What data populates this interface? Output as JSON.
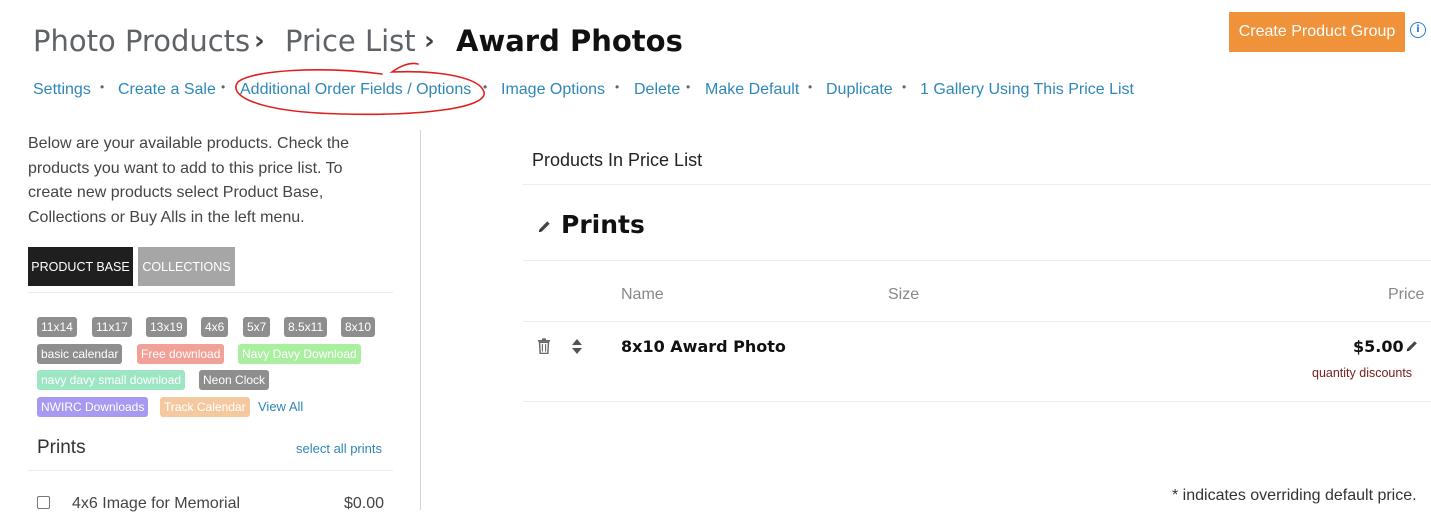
{
  "breadcrumb": {
    "items": [
      "Photo Products",
      "Price List"
    ],
    "current": "Award Photos"
  },
  "header": {
    "create_group_label": "Create Product Group",
    "info_symbol": "i"
  },
  "actions": {
    "links": [
      "Settings",
      "Create a Sale",
      "Additional Order Fields / Options",
      "Image Options",
      "Delete",
      "Make Default",
      "Duplicate",
      "1 Gallery Using This Price List"
    ],
    "separator": "•",
    "highlight_color": "#e0201c"
  },
  "left": {
    "intro": "Below are your available products. Check the products you want to add to this price list. To create new products select Product Base, Collections or Buy Alls in the left menu.",
    "tabs": {
      "product_base": "PRODUCT BASE",
      "collections": "COLLECTIONS"
    },
    "tags": [
      {
        "label": "11x14",
        "color": "#8e8e8e"
      },
      {
        "label": "11x17",
        "color": "#8e8e8e"
      },
      {
        "label": "13x19",
        "color": "#8e8e8e"
      },
      {
        "label": "4x6",
        "color": "#8e8e8e"
      },
      {
        "label": "5x7",
        "color": "#8e8e8e"
      },
      {
        "label": "8.5x11",
        "color": "#8e8e8e"
      },
      {
        "label": "8x10",
        "color": "#8e8e8e"
      },
      {
        "label": "basic calendar",
        "color": "#8e8e8e"
      },
      {
        "label": "Free download",
        "color": "#f2a198"
      },
      {
        "label": "Navy Davy Download",
        "color": "#a9ef9f"
      },
      {
        "label": "navy davy small download",
        "color": "#9de6c3"
      },
      {
        "label": "Neon Clock",
        "color": "#8e8e8e"
      },
      {
        "label": "NWIRC Downloads",
        "color": "#a89af2"
      },
      {
        "label": "Track Calendar",
        "color": "#f5c9a0"
      }
    ],
    "view_all": "View All",
    "prints_heading": "Prints",
    "select_all": "select all prints",
    "products": [
      {
        "name": "4x6 Image for Memorial",
        "price": "$0.00"
      }
    ]
  },
  "right": {
    "title": "Products In Price List",
    "group_title": "Prints",
    "columns": {
      "name": "Name",
      "size": "Size",
      "price": "Price"
    },
    "items": [
      {
        "name": "8x10 Award Photo",
        "size": "",
        "price": "$5.00",
        "discount_link": "quantity discounts"
      }
    ],
    "footnote": "* indicates overriding default price."
  },
  "colors": {
    "accent_orange": "#f0923a",
    "link_blue": "#2e87b9",
    "active_tab": "#1f1f1f",
    "inactive_tab": "#a6a6a6"
  }
}
